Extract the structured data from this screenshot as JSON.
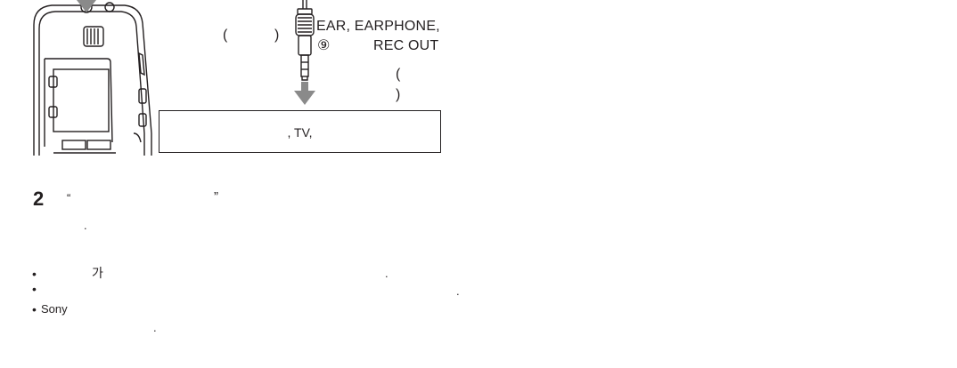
{
  "diagram": {
    "paren_open_left": "(",
    "paren_close_left": ")",
    "jack_label_line1": "EAR, EARPHONE,",
    "jack_symbol": "⑨",
    "jack_label_line2": "REC OUT",
    "paren_open_right": "(",
    "paren_close_right": ")",
    "device_box_label": ", TV,"
  },
  "step": {
    "number": "2",
    "open_quote": "“",
    "close_quote": "”",
    "line2_period": "."
  },
  "notes": [
    {
      "bullet": "•",
      "text": "가",
      "period": "."
    },
    {
      "bullet": "•",
      "text": "",
      "period": "."
    },
    {
      "bullet": "•",
      "text": "Sony",
      "period": "."
    }
  ]
}
